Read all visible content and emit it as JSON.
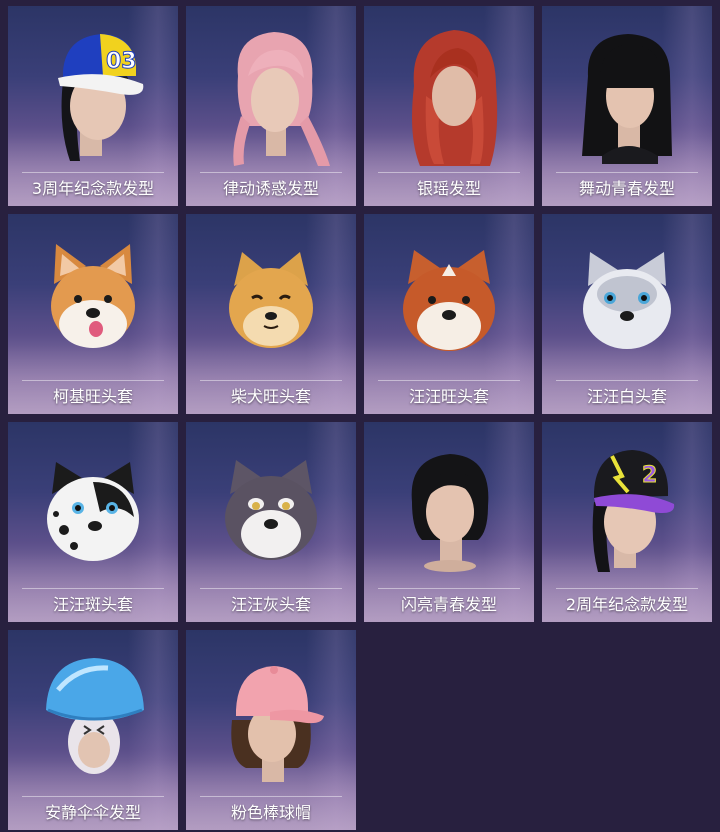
{
  "items": [
    {
      "name": "3周年纪念款发型"
    },
    {
      "name": "律动诱惑发型"
    },
    {
      "name": "银瑶发型"
    },
    {
      "name": "舞动青春发型"
    },
    {
      "name": "柯基旺头套"
    },
    {
      "name": "柴犬旺头套"
    },
    {
      "name": "汪汪旺头套"
    },
    {
      "name": "汪汪白头套"
    },
    {
      "name": "汪汪斑头套"
    },
    {
      "name": "汪汪灰头套"
    },
    {
      "name": "闪亮青春发型"
    },
    {
      "name": "2周年纪念款发型"
    },
    {
      "name": "安静伞伞发型"
    },
    {
      "name": "粉色棒球帽"
    }
  ],
  "cap_text": {
    "anniversary3": "03",
    "anniversary2": "2"
  },
  "colors": {
    "background": "#28203f",
    "label_text": "#ffffff"
  }
}
